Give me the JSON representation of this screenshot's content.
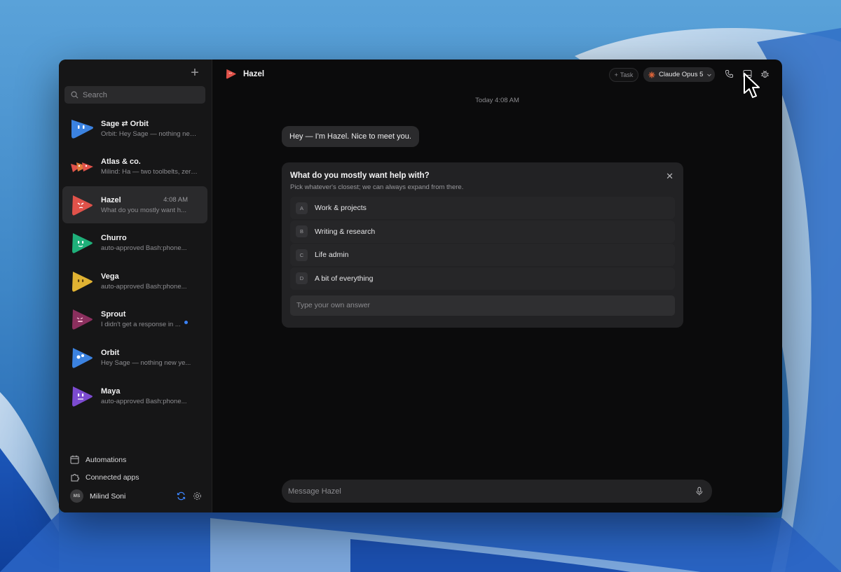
{
  "sidebar": {
    "new_chat_label": "+",
    "search_placeholder": "Search",
    "chats": [
      {
        "name": "Sage ⇄ Orbit",
        "preview": "Orbit: Hey Sage — nothing new y...",
        "color": "#3b82e0"
      },
      {
        "name": "Atlas & co.",
        "preview": "Milind: Ha — two toolbelts, zero t...",
        "color": "#e0524a"
      },
      {
        "name": "Hazel",
        "preview": "What do you mostly want h...",
        "time": "4:08 AM",
        "color": "#e0524a"
      },
      {
        "name": "Churro",
        "preview": "auto-approved Bash:phone...",
        "color": "#1fb07a"
      },
      {
        "name": "Vega",
        "preview": "auto-approved Bash:phone...",
        "color": "#e0b232"
      },
      {
        "name": "Sprout",
        "preview": "I didn't get a response in ...",
        "color": "#8b2f5e"
      },
      {
        "name": "Orbit",
        "preview": "Hey Sage — nothing new ye...",
        "color": "#3b82e0"
      },
      {
        "name": "Maya",
        "preview": "auto-approved Bash:phone...",
        "color": "#7c4bd0"
      }
    ],
    "automations_label": "Automations",
    "connected_apps_label": "Connected apps",
    "user_initials": "MS",
    "user_name": "Milind Soni"
  },
  "header": {
    "agent_name": "Hazel",
    "task_label": "Task",
    "model_label": "Claude Opus 5"
  },
  "conversation": {
    "date_separator": "Today 4:08 AM",
    "greeting": "Hey — I'm Hazel. Nice to meet you.",
    "question": {
      "title": "What do you mostly want help with?",
      "subtitle": "Pick whatever's closest; we can always expand from there.",
      "options": [
        {
          "letter": "A",
          "label": "Work & projects"
        },
        {
          "letter": "B",
          "label": "Writing & research"
        },
        {
          "letter": "C",
          "label": "Life admin"
        },
        {
          "letter": "D",
          "label": "A bit of everything"
        }
      ],
      "own_answer_placeholder": "Type your own answer"
    }
  },
  "composer": {
    "placeholder": "Message Hazel"
  },
  "colors": {
    "accent_blue": "#3b82f6",
    "model_icon": "#e0663a",
    "sync_icon": "#3b82f6"
  }
}
